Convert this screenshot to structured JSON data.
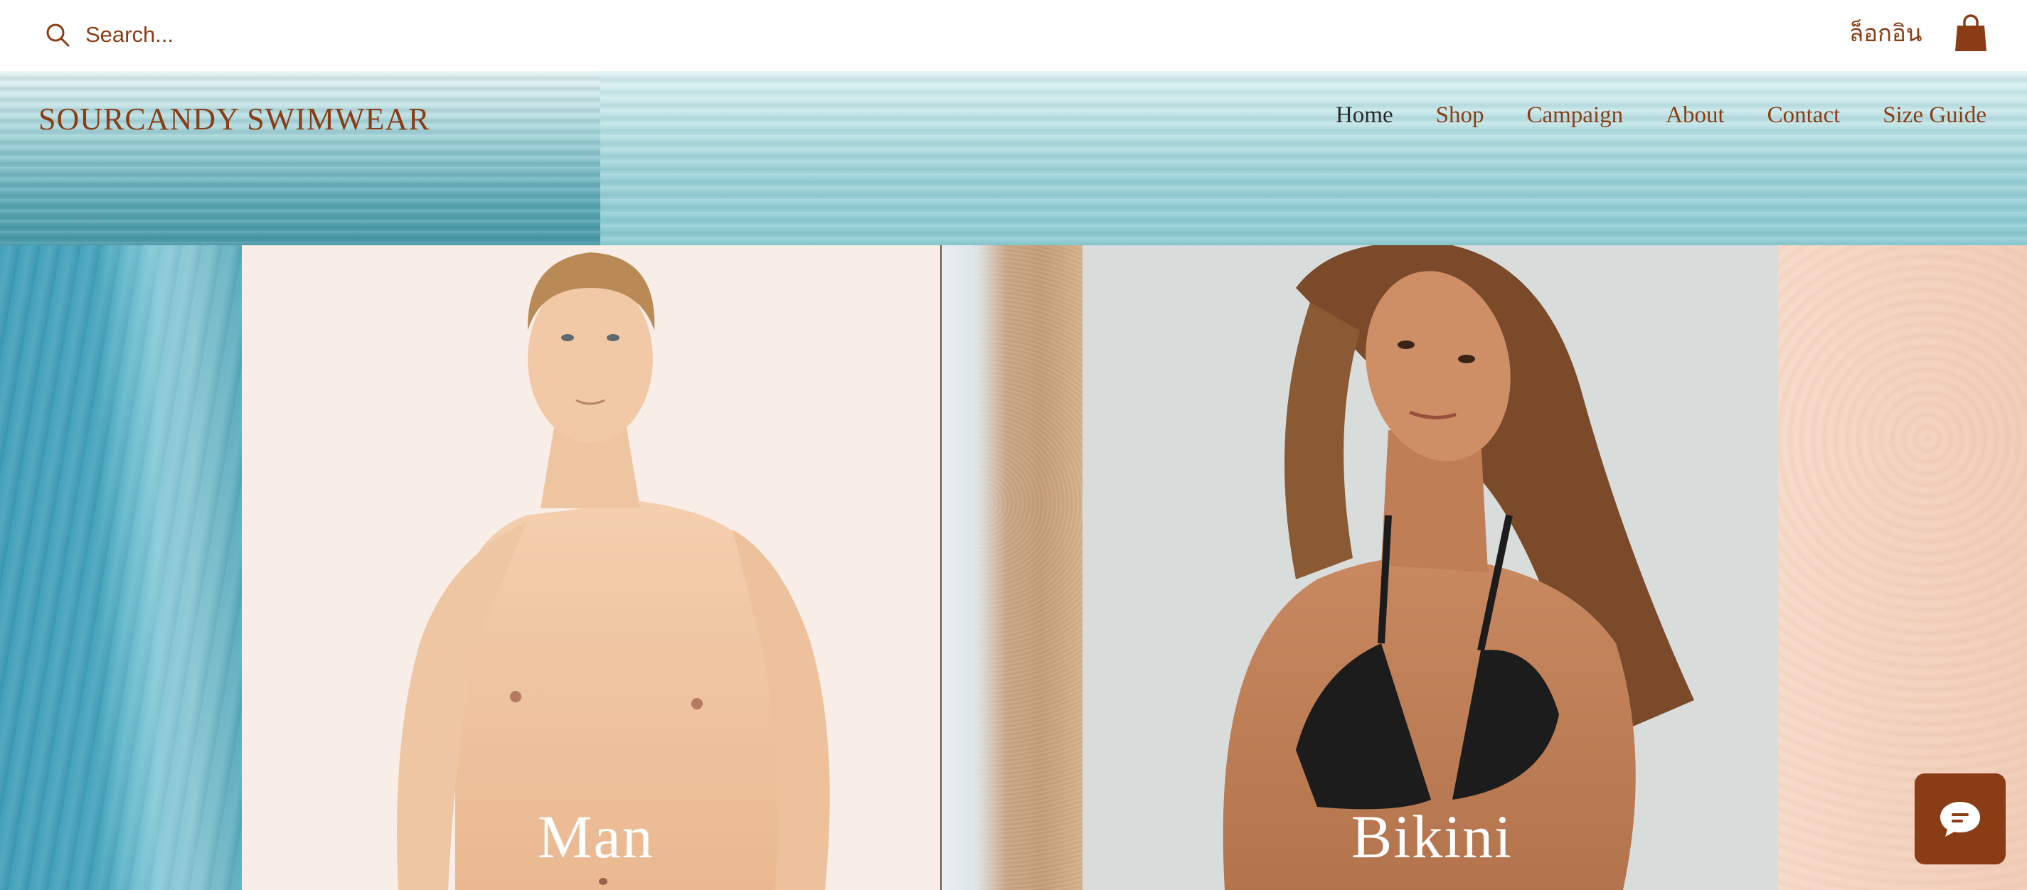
{
  "topbar": {
    "search_placeholder": "Search...",
    "login_label": "ล็อกอิน"
  },
  "header": {
    "brand": "SOURCANDY SWIMWEAR",
    "nav": [
      {
        "label": "Home",
        "active": true
      },
      {
        "label": "Shop"
      },
      {
        "label": "Campaign"
      },
      {
        "label": "About"
      },
      {
        "label": "Contact"
      },
      {
        "label": "Size Guide"
      }
    ]
  },
  "collections": [
    {
      "label": "Man"
    },
    {
      "label": "Bikini"
    }
  ],
  "colors": {
    "accent": "#8a3d14",
    "nav_active": "#2b2b2b"
  },
  "icons": {
    "search": "search-icon",
    "cart": "shopping-bag-icon",
    "chat": "chat-bubble-icon"
  }
}
